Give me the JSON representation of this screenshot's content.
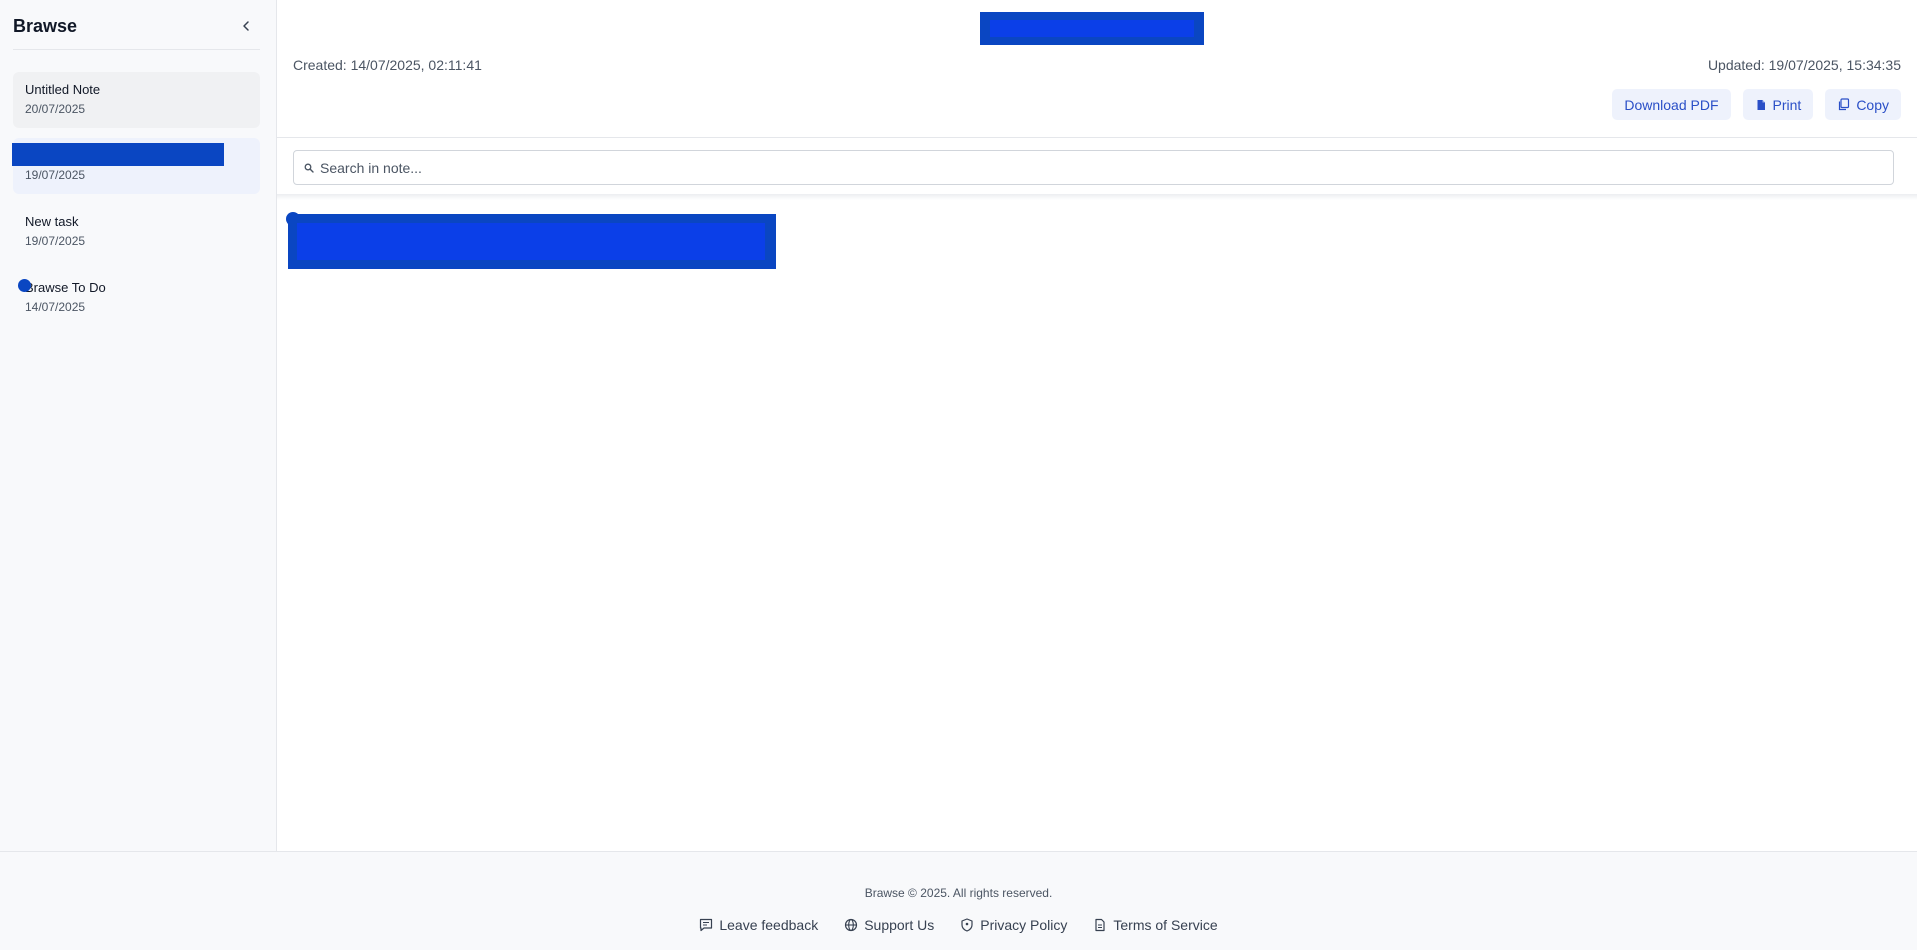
{
  "sidebar": {
    "brand": "Brawse",
    "notes": [
      {
        "title": "Untitled Note",
        "date": "20/07/2025"
      },
      {
        "title": "",
        "date": "19/07/2025"
      },
      {
        "title": "New task",
        "date": "19/07/2025"
      },
      {
        "title": "Brawse To Do",
        "date": "14/07/2025"
      }
    ]
  },
  "note": {
    "created": "Created: 14/07/2025, 02:11:41",
    "updated": "Updated: 19/07/2025, 15:34:35"
  },
  "toolbar": {
    "download_label": "Download PDF",
    "print_label": "Print",
    "copy_label": "Copy"
  },
  "search": {
    "placeholder": "Search in note..."
  },
  "footer": {
    "copyright": "Brawse © 2025. All rights reserved.",
    "links": [
      "Leave feedback",
      "Support Us",
      "Privacy Policy",
      "Terms of Service"
    ]
  },
  "colors": {
    "accent": "#2a4fc7",
    "redaction": "#0a46c2",
    "button_bg": "#eef2fc"
  },
  "icons": {
    "collapse": "chevron-left-icon",
    "search": "search-icon",
    "print": "document-icon",
    "copy": "copy-icon",
    "feedback": "message-icon",
    "support": "globe-icon",
    "privacy": "shield-icon",
    "terms": "file-text-icon"
  }
}
